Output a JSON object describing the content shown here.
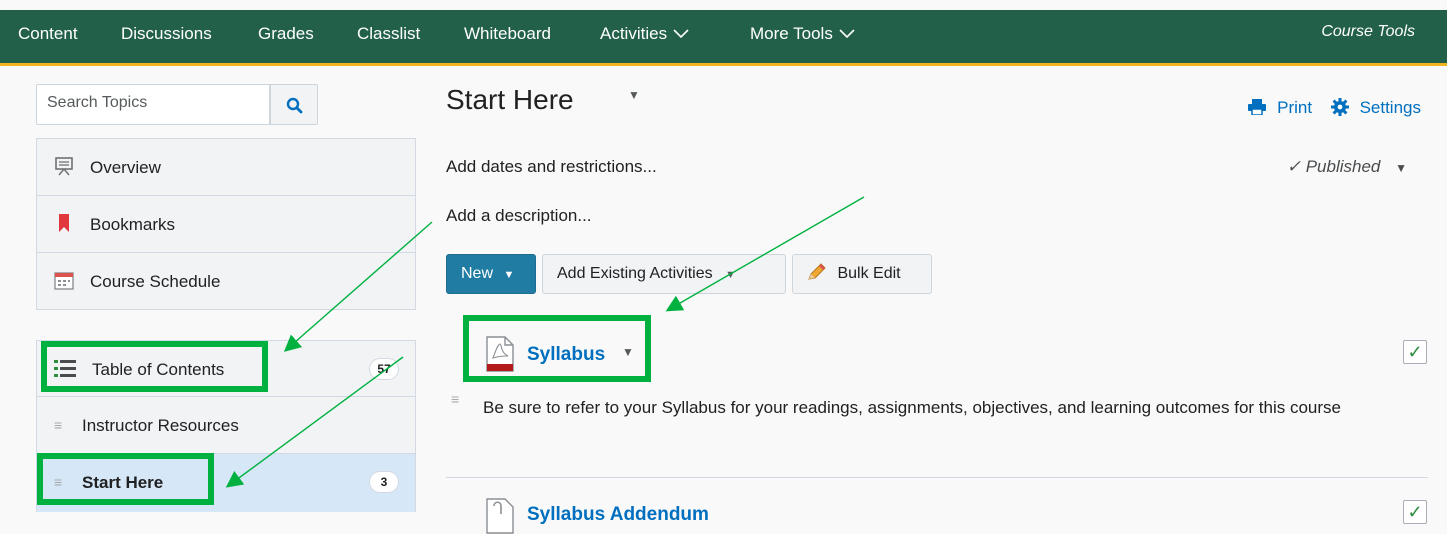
{
  "topnav": {
    "items": [
      "Content",
      "Discussions",
      "Grades",
      "Classlist",
      "Whiteboard",
      "Activities",
      "More Tools"
    ],
    "course_tools": "Course Tools"
  },
  "sidebar": {
    "search_placeholder": "Search Topics",
    "items": [
      {
        "label": "Overview",
        "icon": "presentation-icon"
      },
      {
        "label": "Bookmarks",
        "icon": "bookmark-icon"
      },
      {
        "label": "Course Schedule",
        "icon": "calendar-icon"
      }
    ],
    "toc": {
      "label": "Table of Contents",
      "count": "57",
      "icon": "list-icon"
    },
    "modules": [
      {
        "label": "Instructor Resources",
        "count": ""
      },
      {
        "label": "Start Here",
        "count": "3",
        "selected": true
      }
    ]
  },
  "main": {
    "title": "Start Here",
    "print_label": "Print",
    "settings_label": "Settings",
    "add_dates": "Add dates and restrictions...",
    "add_description": "Add a description...",
    "published": "Published",
    "buttons": {
      "new": "New",
      "add_existing": "Add Existing Activities",
      "bulk_edit": "Bulk Edit"
    },
    "topics": [
      {
        "title": "Syllabus",
        "icon": "pdf-icon",
        "description": "Be sure to refer to your Syllabus for your readings, assignments, objectives, and learning outcomes for this course",
        "completed": true
      },
      {
        "title": "Syllabus Addendum",
        "icon": "attachment-icon",
        "completed": true
      }
    ]
  },
  "colors": {
    "nav_bg": "#22604a",
    "nav_accent": "#f1b41c",
    "link": "#006fbf",
    "primary_button": "#217ca3",
    "highlight": "#00b140",
    "selected_row": "#d6e7f7"
  }
}
